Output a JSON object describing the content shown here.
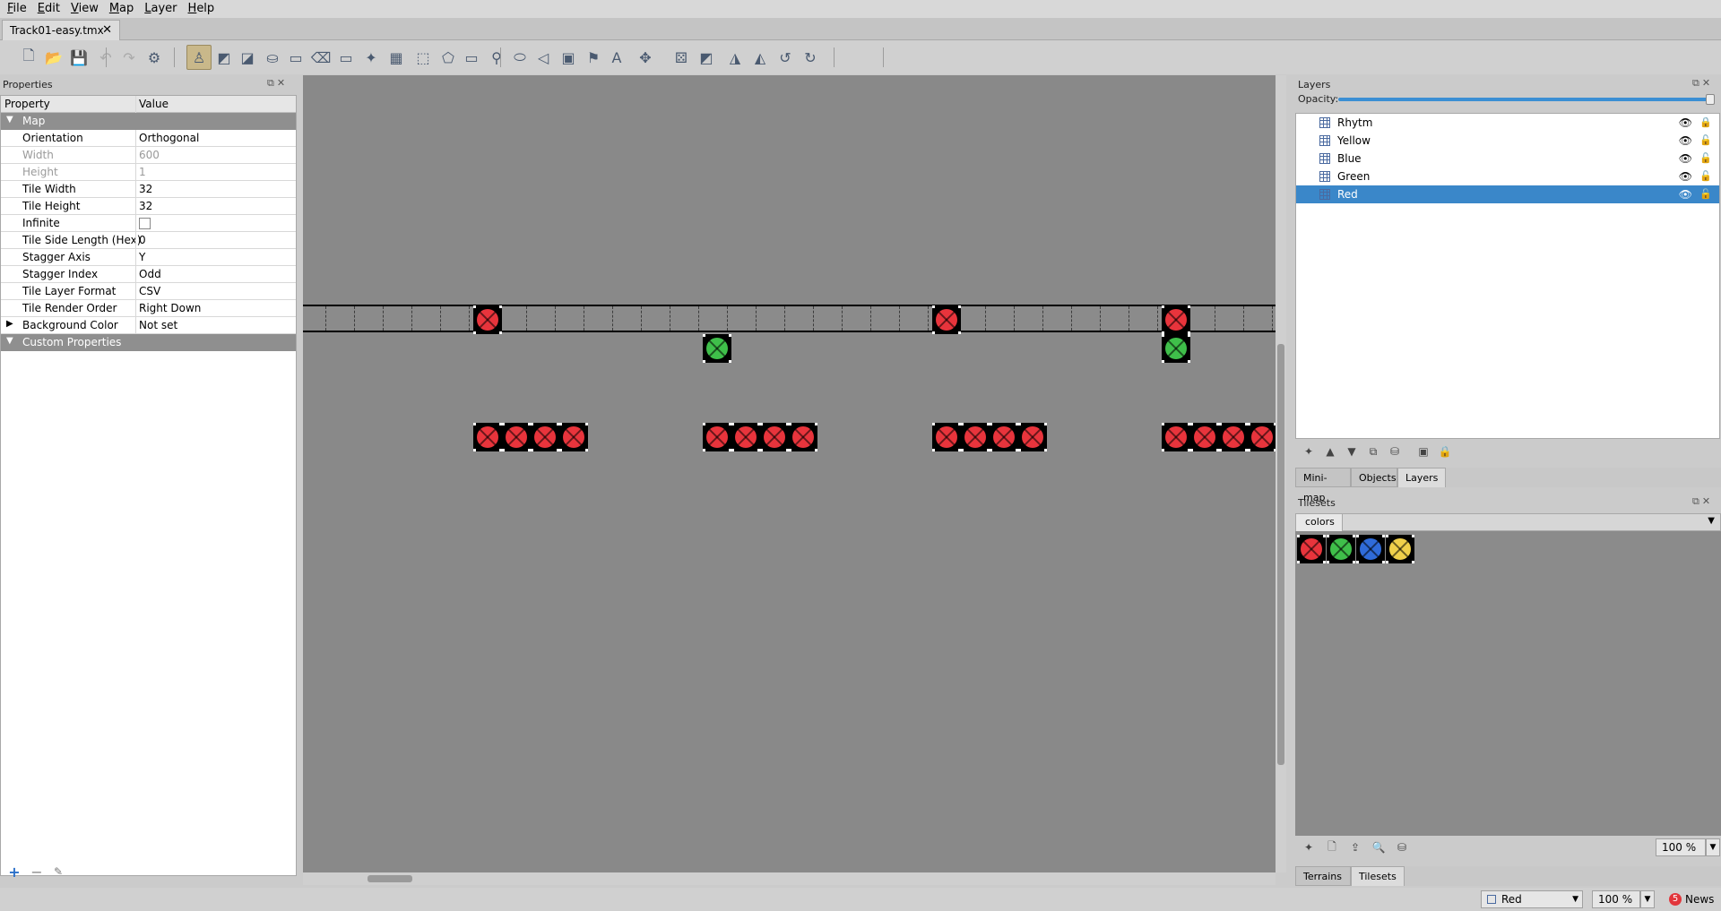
{
  "menubar": {
    "items": [
      {
        "u": "F",
        "rest": "ile"
      },
      {
        "u": "E",
        "rest": "dit"
      },
      {
        "u": "V",
        "rest": "iew"
      },
      {
        "u": "M",
        "rest": "ap"
      },
      {
        "u": "L",
        "rest": "ayer"
      },
      {
        "u": "H",
        "rest": "elp"
      }
    ]
  },
  "document": {
    "tab_label": "Track01-easy.tmx",
    "close_glyph": "✕"
  },
  "toolbar": {
    "icons": [
      "new-file-icon",
      "open-file-icon",
      "save-icon",
      "undo-icon",
      "redo-icon",
      "commands-icon",
      "stamp-brush-icon",
      "terrain-brush-icon",
      "wang-brush-icon",
      "bucket-fill-icon",
      "shape-fill-icon",
      "eraser-icon",
      "rectangular-select-icon",
      "magic-wand-icon",
      "select-same-tile-icon",
      "select-objects-icon",
      "edit-polygons-icon",
      "insert-rectangle-icon",
      "insert-point-icon",
      "insert-ellipse-icon",
      "insert-polygon-icon",
      "insert-tile-icon",
      "insert-template-icon",
      "insert-text-icon",
      "layer-offset-icon",
      "random-mode-icon",
      "wang-fill-mode-icon",
      "flip-horizontal-icon",
      "flip-vertical-icon",
      "rotate-left-icon",
      "rotate-right-icon"
    ]
  },
  "properties": {
    "title": "Properties",
    "col_property": "Property",
    "col_value": "Value",
    "group_map": "Map",
    "rows": [
      {
        "key": "Orientation",
        "value": "Orthogonal",
        "disabled": false
      },
      {
        "key": "Width",
        "value": "600",
        "disabled": true
      },
      {
        "key": "Height",
        "value": "1",
        "disabled": true
      },
      {
        "key": "Tile Width",
        "value": "32",
        "disabled": false
      },
      {
        "key": "Tile Height",
        "value": "32",
        "disabled": false
      },
      {
        "key": "Infinite",
        "value": "",
        "disabled": false,
        "checkbox": true
      },
      {
        "key": "Tile Side Length (Hex)",
        "value": "0",
        "disabled": false
      },
      {
        "key": "Stagger Axis",
        "value": "Y",
        "disabled": false
      },
      {
        "key": "Stagger Index",
        "value": "Odd",
        "disabled": false
      },
      {
        "key": "Tile Layer Format",
        "value": "CSV",
        "disabled": false
      },
      {
        "key": "Tile Render Order",
        "value": "Right Down",
        "disabled": false
      },
      {
        "key": "Background Color",
        "value": "Not set",
        "disabled": false
      }
    ],
    "group_custom": "Custom Properties"
  },
  "layers": {
    "title": "Layers",
    "opacity_label": "Opacity:",
    "opacity": 1.0,
    "items": [
      {
        "name": "Rhytm",
        "selected": false,
        "locked": true
      },
      {
        "name": "Yellow",
        "selected": false,
        "locked": false
      },
      {
        "name": "Blue",
        "selected": false,
        "locked": false
      },
      {
        "name": "Green",
        "selected": false,
        "locked": false
      },
      {
        "name": "Red",
        "selected": true,
        "locked": false
      }
    ],
    "tabs": [
      "Mini-map",
      "Objects",
      "Layers"
    ],
    "active_tab": "Layers"
  },
  "tilesets": {
    "title": "Tilesets",
    "tab": "colors",
    "tiles": [
      "red",
      "green",
      "blue",
      "yellow"
    ],
    "zoom": "100 %",
    "tabs": [
      "Terrains",
      "Tilesets"
    ],
    "active_tab": "Tilesets"
  },
  "colors": {
    "red": "#e8343c",
    "green": "#3fbf4a",
    "blue": "#2f6bd9",
    "yellow": "#f0d04a",
    "selection": "#3a87c9"
  },
  "status": {
    "layer": "Red",
    "zoom": "100 %",
    "news_count": "5",
    "news_label": "News"
  }
}
